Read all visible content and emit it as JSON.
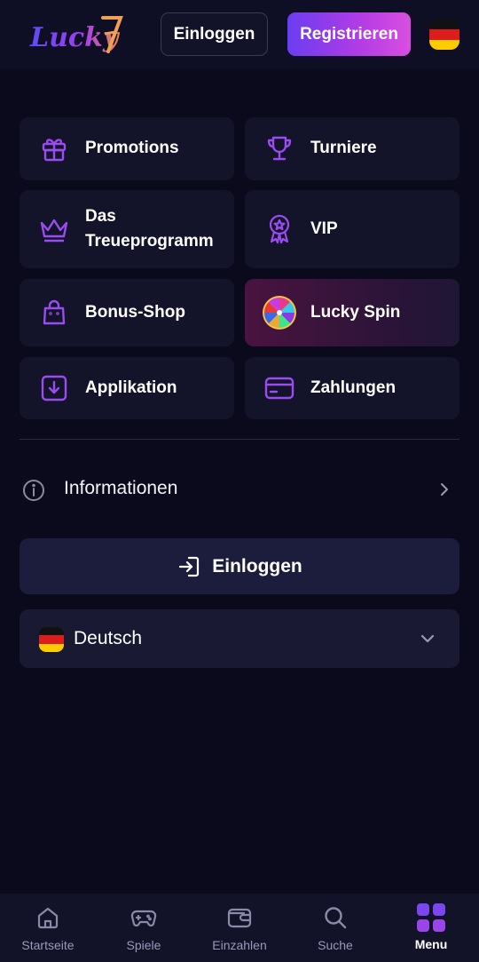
{
  "header": {
    "logo_text": "Lucky7",
    "login_label": "Einloggen",
    "register_label": "Registrieren",
    "flag_icon": "germany-flag-icon"
  },
  "menu": {
    "items": [
      {
        "label": "Promotions",
        "icon": "gift-icon"
      },
      {
        "label": "Turniere",
        "icon": "trophy-icon"
      },
      {
        "label": "Das",
        "label2": "Treueprogramm",
        "icon": "crown-icon"
      },
      {
        "label": "VIP",
        "icon": "vip-badge-icon"
      },
      {
        "label": "Bonus-Shop",
        "icon": "shopping-bag-icon"
      },
      {
        "label": "Lucky Spin",
        "icon": "wheel-icon"
      },
      {
        "label": "Applikation",
        "icon": "download-icon"
      },
      {
        "label": "Zahlungen",
        "icon": "credit-card-icon"
      }
    ]
  },
  "info": {
    "label": "Informationen"
  },
  "login_button": {
    "label": "Einloggen"
  },
  "language": {
    "label": "Deutsch"
  },
  "bottom_nav": {
    "items": [
      {
        "label": "Startseite",
        "icon": "home-icon"
      },
      {
        "label": "Spiele",
        "icon": "gamepad-icon"
      },
      {
        "label": "Einzahlen",
        "icon": "wallet-icon"
      },
      {
        "label": "Suche",
        "icon": "search-icon"
      },
      {
        "label": "Menu",
        "icon": "menu-grid-icon",
        "active": true
      }
    ]
  },
  "colors": {
    "background": "#0a0a1c",
    "card": "#13132a",
    "accent_purple": "#8b3cf0",
    "accent_pink": "#d94fe0"
  }
}
